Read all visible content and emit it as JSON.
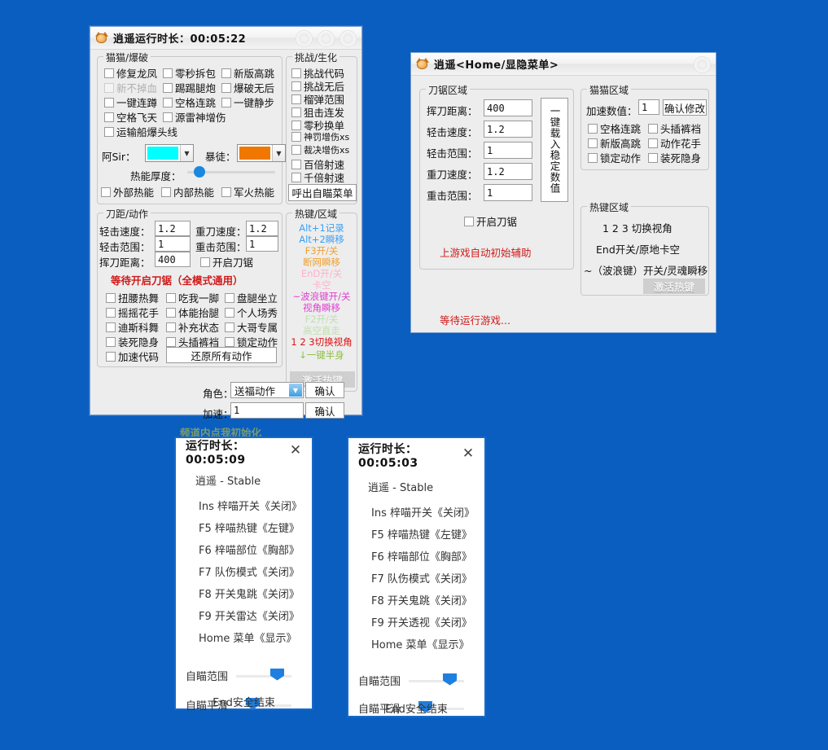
{
  "desktop": {
    "background_color": "#0a5ec0"
  },
  "window_main": {
    "title": "逍遥运行时长：00:05:22",
    "icon": "cat-face-icon",
    "groups": {
      "cat_blast": {
        "title": "猫猫/爆破",
        "checkboxes": [
          {
            "label": "修复龙凤",
            "disabled": false
          },
          {
            "label": "零秒拆包",
            "disabled": false
          },
          {
            "label": "新版高跳",
            "disabled": false
          },
          {
            "label": "新不掉血",
            "disabled": true
          },
          {
            "label": "踢踢腿炮",
            "disabled": false
          },
          {
            "label": "爆破无后",
            "disabled": false
          },
          {
            "label": "一键连蹲",
            "disabled": false
          },
          {
            "label": "空格连跳",
            "disabled": false
          },
          {
            "label": "一键静步",
            "disabled": false
          },
          {
            "label": "空格飞天",
            "disabled": false
          },
          {
            "label": "源雷神增伤",
            "disabled": false
          },
          {
            "label": "运输船爆头线",
            "disabled": false
          }
        ],
        "color_a_label": "阿Sir：",
        "color_a_value": "#00FFFF",
        "color_b_label": "暴徒：",
        "color_b_value": "#F07800",
        "slider_label": "热能厚度：",
        "slider_percent": 8,
        "heat_checks": [
          "外部热能",
          "内部热能",
          "军火热能"
        ]
      },
      "challenge": {
        "title": "挑战/生化",
        "checkboxes": [
          "挑战代码",
          "挑战无后",
          "榴弹范围",
          "狙击连发",
          "零秒换单",
          "神罚增伤xs",
          "裁决增伤xs",
          "百倍射速",
          "千倍射速"
        ],
        "button": "呼出自瞄菜单"
      },
      "blade": {
        "title": "刀距/动作",
        "fields": [
          {
            "label": "轻击速度：",
            "value": "1.2"
          },
          {
            "label": "重刀速度：",
            "value": "1.2"
          },
          {
            "label": "轻击范围：",
            "value": "1"
          },
          {
            "label": "重击范围：",
            "value": "1"
          },
          {
            "label": "挥刀距离：",
            "value": "400"
          }
        ],
        "enable_check": "开启刀锯",
        "warning": "等待开启刀锯（全模式通用）",
        "action_checks": [
          "扭腰热舞",
          "吃我一脚",
          "盘腿坐立",
          "摇摇花手",
          "体能抬腿",
          "个人场秀",
          "迪斯科舞",
          "补充状态",
          "大哥专属",
          "装死隐身",
          "头插裤裆",
          "锁定动作",
          "加速代码"
        ],
        "restore_button": "还原所有动作"
      },
      "hotkey": {
        "title": "热键/区域",
        "lines": [
          {
            "text": "Alt+1记录",
            "color": "#3aa0f5"
          },
          {
            "text": "Alt+2瞬移",
            "color": "#3aa0f5"
          },
          {
            "text": "F3开/关",
            "color": "#f0a030"
          },
          {
            "text": "断网瞬移",
            "color": "#f0a030"
          },
          {
            "text": "EnD开/关",
            "color": "#ffb0cc"
          },
          {
            "text": "卡空",
            "color": "#ffb0cc"
          },
          {
            "text": "~波浪键开/关",
            "color": "#e040d0"
          },
          {
            "text": "视角瞬移",
            "color": "#e040d0"
          },
          {
            "text": "F2开/关",
            "color": "#bfe0b0"
          },
          {
            "text": "高空直走",
            "color": "#bfe0b0"
          },
          {
            "text": "1 2 3切换视角",
            "color": "#e01010"
          },
          {
            "text": "↓一键半身",
            "color": "#8fbf3f"
          }
        ],
        "activate_button": "激活热键"
      }
    },
    "footer": {
      "role_label": "角色：",
      "role_value": "送福动作",
      "role_confirm": "确认",
      "speed_label": "加速：",
      "speed_value": "1",
      "speed_confirm": "确认",
      "init_text": "频道内点我初始化"
    }
  },
  "window_menu": {
    "title": "逍遥<Home/显隐菜单>",
    "icon": "cat-face-icon",
    "blade_group": {
      "title": "刀锯区域",
      "fields": [
        {
          "label": "挥刀距离：",
          "value": "400"
        },
        {
          "label": "轻击速度：",
          "value": "1.2"
        },
        {
          "label": "轻击范围：",
          "value": "1"
        },
        {
          "label": "重刀速度：",
          "value": "1.2"
        },
        {
          "label": "重击范围：",
          "value": "1"
        }
      ],
      "vertical_button": "一键载入稳定数值",
      "enable_check": "开启刀锯",
      "notice": "上游戏自动初始辅助"
    },
    "cat_group": {
      "title": "猫猫区域",
      "speed_label": "加速数值：",
      "speed_value": "1",
      "confirm_button": "确认修改",
      "checkboxes": [
        "空格连跳",
        "头插裤裆",
        "新版高跳",
        "动作花手",
        "锁定动作",
        "装死隐身"
      ]
    },
    "hotkey_group": {
      "title": "热键区域",
      "lines": [
        "1 2 3 切换视角",
        "End开关/原地卡空",
        "~（波浪键）开关/灵魂瞬移"
      ],
      "activate_button": "激活热键"
    },
    "status": "等待运行游戏..."
  },
  "overlay_left": {
    "title": "运行时长：00:05:09",
    "close_icon": "close-icon",
    "subtitle": "逍遥 - Stable",
    "rows": [
      {
        "key": "Ins 梓喵开关",
        "value": "《关闭》"
      },
      {
        "key": "F5  梓喵热键",
        "value": "《左键》"
      },
      {
        "key": "F6  梓喵部位",
        "value": "《胸部》"
      },
      {
        "key": "F7  队伤模式",
        "value": "《关闭》"
      },
      {
        "key": "F8  开关鬼跳",
        "value": "《关闭》"
      },
      {
        "key": "F9  开关雷达",
        "value": "《关闭》"
      },
      {
        "key": "Home 菜单",
        "value": "《显示》"
      }
    ],
    "sliders": [
      {
        "label": "自瞄范围",
        "percent": 62
      },
      {
        "label": "自瞄平滑",
        "percent": 18
      }
    ],
    "footer": "End安全结束"
  },
  "overlay_right": {
    "title": "运行时长：00:05:03",
    "close_icon": "close-icon",
    "subtitle": "逍遥 - Stable",
    "rows": [
      {
        "key": "Ins 梓喵开关",
        "value": "《关闭》"
      },
      {
        "key": "F5  梓喵热键",
        "value": "《左键》"
      },
      {
        "key": "F6  梓喵部位",
        "value": "《胸部》"
      },
      {
        "key": "F7  队伤模式",
        "value": "《关闭》"
      },
      {
        "key": "F8  开关鬼跳",
        "value": "《关闭》"
      },
      {
        "key": "F9  开关透视",
        "value": "《关闭》"
      },
      {
        "key": "Home 菜单",
        "value": "《显示》"
      }
    ],
    "sliders": [
      {
        "label": "自瞄范围",
        "percent": 62
      },
      {
        "label": "自瞄平滑",
        "percent": 18
      }
    ],
    "footer": "End安全结束"
  }
}
